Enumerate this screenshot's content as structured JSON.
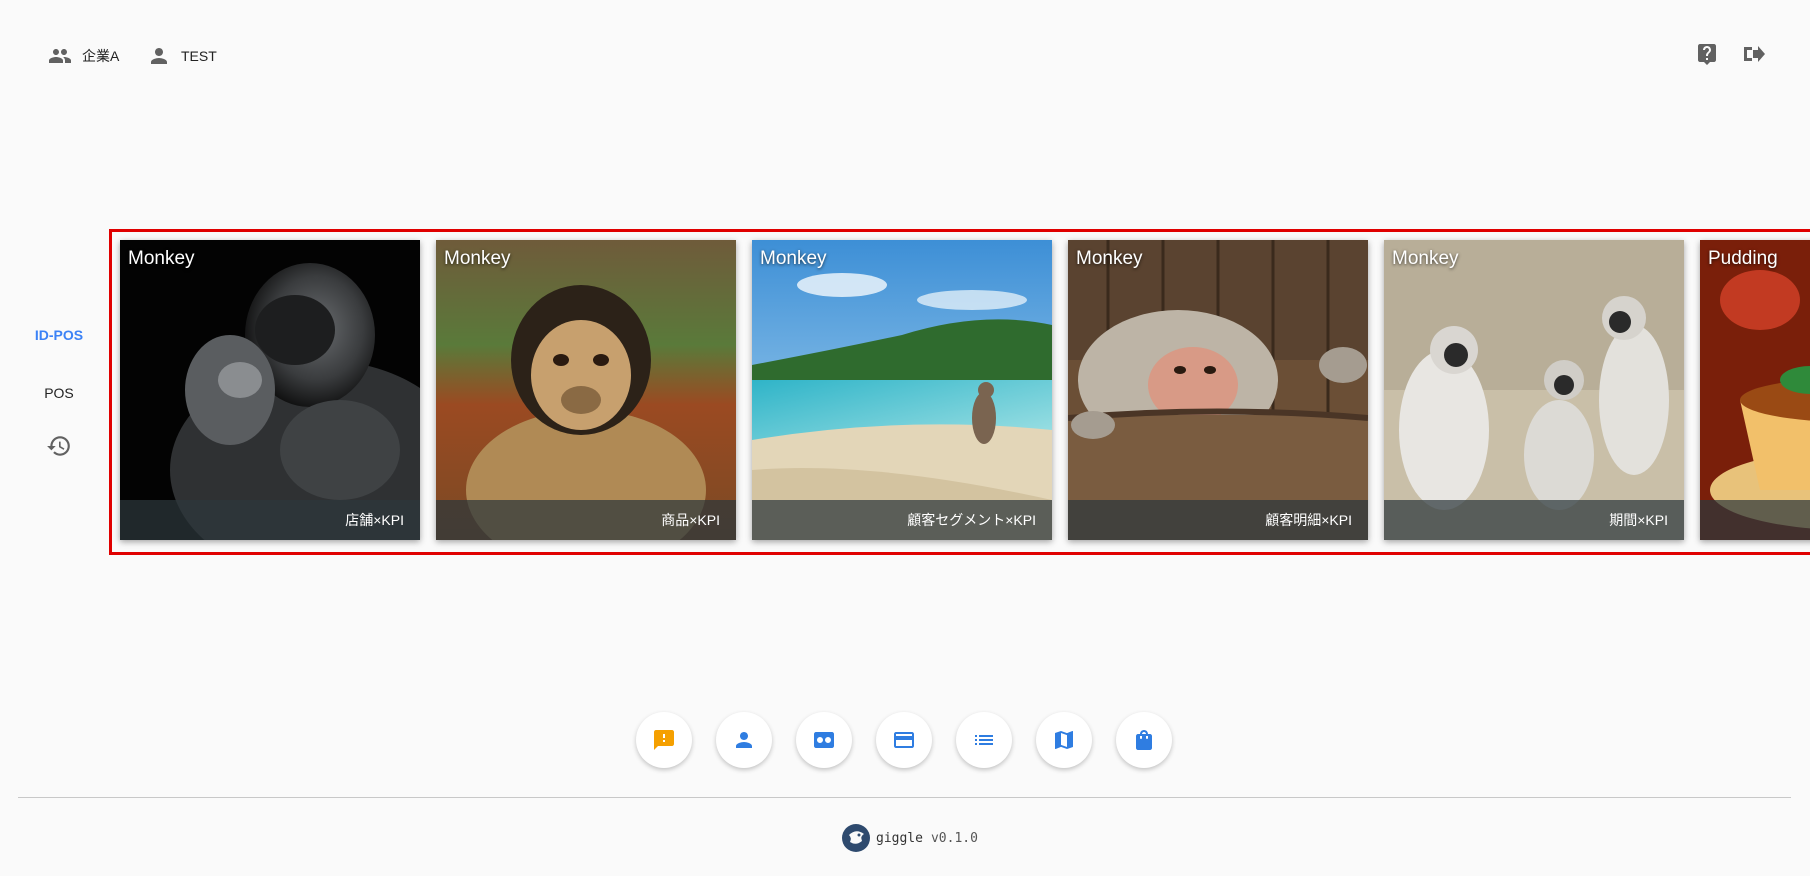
{
  "header": {
    "company": {
      "label": "企業A",
      "icon": "group-icon"
    },
    "user": {
      "label": "TEST",
      "icon": "person-icon"
    },
    "help_icon": "help-icon",
    "logout_icon": "logout-icon"
  },
  "nav": {
    "items": [
      {
        "label": "ID-POS",
        "active": true
      },
      {
        "label": "POS",
        "active": false
      }
    ],
    "history_icon": "history-icon"
  },
  "carousel": {
    "cards": [
      {
        "title": "Monkey",
        "caption": "店舗×KPI",
        "image": "gorilla-photo"
      },
      {
        "title": "Monkey",
        "caption": "商品×KPI",
        "image": "capuchin-photo"
      },
      {
        "title": "Monkey",
        "caption": "顧客セグメント×KPI",
        "image": "beach-monkey-photo"
      },
      {
        "title": "Monkey",
        "caption": "顧客明細×KPI",
        "image": "baboon-barrel-photo"
      },
      {
        "title": "Monkey",
        "caption": "期間×KPI",
        "image": "langurs-photo"
      },
      {
        "title": "Pudding",
        "caption": "",
        "image": "pudding-photo"
      }
    ],
    "highlight_color": "#e00000"
  },
  "actions": [
    {
      "icon": "feedback-icon",
      "color": "#f5a000"
    },
    {
      "icon": "person-icon",
      "color": "#2f7de1"
    },
    {
      "icon": "id-card-icon",
      "color": "#2f7de1"
    },
    {
      "icon": "credit-card-icon",
      "color": "#2f7de1"
    },
    {
      "icon": "list-icon",
      "color": "#2f7de1"
    },
    {
      "icon": "map-icon",
      "color": "#2f7de1"
    },
    {
      "icon": "shopping-bag-icon",
      "color": "#2f7de1"
    }
  ],
  "footer": {
    "app_name": "giggle",
    "version": "v0.1.0"
  }
}
